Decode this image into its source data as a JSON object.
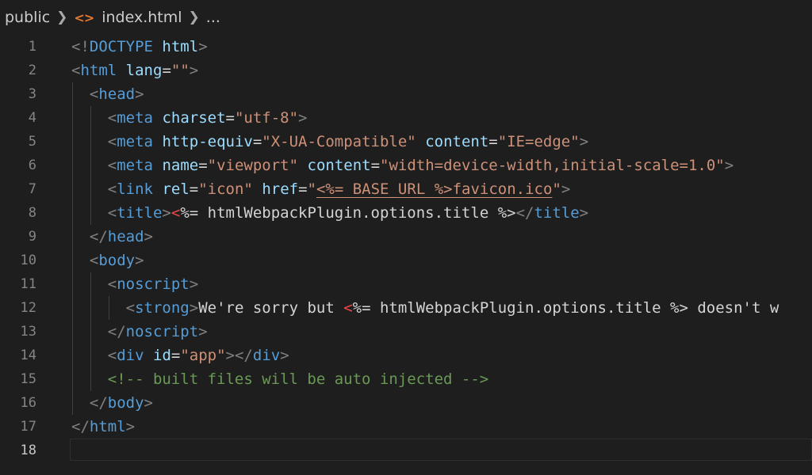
{
  "breadcrumb": {
    "folder": "public",
    "file_icon": "<>",
    "file": "index.html",
    "more": "..."
  },
  "colors": {
    "background": "#1e1e1e",
    "tag": "#569cd6",
    "attribute": "#9cdcfe",
    "string": "#ce9178",
    "comment": "#6a9955",
    "punctuation": "#808080",
    "error_marker": "#f44747",
    "file_icon": "#e37933"
  },
  "editor": {
    "active_line": 18,
    "lines": [
      {
        "n": "1",
        "tokens": [
          [
            "p",
            "<!"
          ],
          [
            "t",
            "DOCTYPE"
          ],
          [
            "x",
            " "
          ],
          [
            "a",
            "html"
          ],
          [
            "p",
            ">"
          ]
        ]
      },
      {
        "n": "2",
        "tokens": [
          [
            "p",
            "<"
          ],
          [
            "t",
            "html"
          ],
          [
            "x",
            " "
          ],
          [
            "a",
            "lang"
          ],
          [
            "x",
            "="
          ],
          [
            "s",
            "\"\""
          ],
          [
            "p",
            ">"
          ]
        ]
      },
      {
        "n": "3",
        "tokens": [
          [
            "x",
            "  "
          ],
          [
            "p",
            "<"
          ],
          [
            "t",
            "head"
          ],
          [
            "p",
            ">"
          ]
        ]
      },
      {
        "n": "4",
        "tokens": [
          [
            "x",
            "    "
          ],
          [
            "p",
            "<"
          ],
          [
            "t",
            "meta"
          ],
          [
            "x",
            " "
          ],
          [
            "a",
            "charset"
          ],
          [
            "x",
            "="
          ],
          [
            "s",
            "\"utf-8\""
          ],
          [
            "p",
            ">"
          ]
        ]
      },
      {
        "n": "5",
        "tokens": [
          [
            "x",
            "    "
          ],
          [
            "p",
            "<"
          ],
          [
            "t",
            "meta"
          ],
          [
            "x",
            " "
          ],
          [
            "a",
            "http-equiv"
          ],
          [
            "x",
            "="
          ],
          [
            "s",
            "\"X-UA-Compatible\""
          ],
          [
            "x",
            " "
          ],
          [
            "a",
            "content"
          ],
          [
            "x",
            "="
          ],
          [
            "s",
            "\"IE=edge\""
          ],
          [
            "p",
            ">"
          ]
        ]
      },
      {
        "n": "6",
        "tokens": [
          [
            "x",
            "    "
          ],
          [
            "p",
            "<"
          ],
          [
            "t",
            "meta"
          ],
          [
            "x",
            " "
          ],
          [
            "a",
            "name"
          ],
          [
            "x",
            "="
          ],
          [
            "s",
            "\"viewport\""
          ],
          [
            "x",
            " "
          ],
          [
            "a",
            "content"
          ],
          [
            "x",
            "="
          ],
          [
            "s",
            "\"width=device-width,initial-scale=1.0\""
          ],
          [
            "p",
            ">"
          ]
        ]
      },
      {
        "n": "7",
        "tokens": [
          [
            "x",
            "    "
          ],
          [
            "p",
            "<"
          ],
          [
            "t",
            "link"
          ],
          [
            "x",
            " "
          ],
          [
            "a",
            "rel"
          ],
          [
            "x",
            "="
          ],
          [
            "s",
            "\"icon\""
          ],
          [
            "x",
            " "
          ],
          [
            "a",
            "href"
          ],
          [
            "x",
            "="
          ],
          [
            "s",
            "\""
          ],
          [
            "u",
            "<%= BASE_URL %>favicon.ico"
          ],
          [
            "s",
            "\""
          ],
          [
            "p",
            ">"
          ]
        ]
      },
      {
        "n": "8",
        "tokens": [
          [
            "x",
            "    "
          ],
          [
            "p",
            "<"
          ],
          [
            "t",
            "title"
          ],
          [
            "p",
            ">"
          ],
          [
            "r",
            "<"
          ],
          [
            "x",
            "%= htmlWebpackPlugin.options.title %>"
          ],
          [
            "p",
            "</"
          ],
          [
            "t",
            "title"
          ],
          [
            "p",
            ">"
          ]
        ]
      },
      {
        "n": "9",
        "tokens": [
          [
            "x",
            "  "
          ],
          [
            "p",
            "</"
          ],
          [
            "t",
            "head"
          ],
          [
            "p",
            ">"
          ]
        ]
      },
      {
        "n": "10",
        "tokens": [
          [
            "x",
            "  "
          ],
          [
            "p",
            "<"
          ],
          [
            "t",
            "body"
          ],
          [
            "p",
            ">"
          ]
        ]
      },
      {
        "n": "11",
        "tokens": [
          [
            "x",
            "    "
          ],
          [
            "p",
            "<"
          ],
          [
            "t",
            "noscript"
          ],
          [
            "p",
            ">"
          ]
        ]
      },
      {
        "n": "12",
        "tokens": [
          [
            "x",
            "      "
          ],
          [
            "p",
            "<"
          ],
          [
            "t",
            "strong"
          ],
          [
            "p",
            ">"
          ],
          [
            "x",
            "We're sorry but "
          ],
          [
            "r",
            "<"
          ],
          [
            "x",
            "%= htmlWebpackPlugin.options.title %> doesn't w"
          ]
        ]
      },
      {
        "n": "13",
        "tokens": [
          [
            "x",
            "    "
          ],
          [
            "p",
            "</"
          ],
          [
            "t",
            "noscript"
          ],
          [
            "p",
            ">"
          ]
        ]
      },
      {
        "n": "14",
        "tokens": [
          [
            "x",
            "    "
          ],
          [
            "p",
            "<"
          ],
          [
            "t",
            "div"
          ],
          [
            "x",
            " "
          ],
          [
            "a",
            "id"
          ],
          [
            "x",
            "="
          ],
          [
            "s",
            "\"app\""
          ],
          [
            "p",
            "></"
          ],
          [
            "t",
            "div"
          ],
          [
            "p",
            ">"
          ]
        ]
      },
      {
        "n": "15",
        "tokens": [
          [
            "x",
            "    "
          ],
          [
            "c",
            "<!-- built files will be auto injected -->"
          ]
        ]
      },
      {
        "n": "16",
        "tokens": [
          [
            "x",
            "  "
          ],
          [
            "p",
            "</"
          ],
          [
            "t",
            "body"
          ],
          [
            "p",
            ">"
          ]
        ]
      },
      {
        "n": "17",
        "tokens": [
          [
            "p",
            "</"
          ],
          [
            "t",
            "html"
          ],
          [
            "p",
            ">"
          ]
        ]
      },
      {
        "n": "18",
        "tokens": []
      }
    ]
  }
}
